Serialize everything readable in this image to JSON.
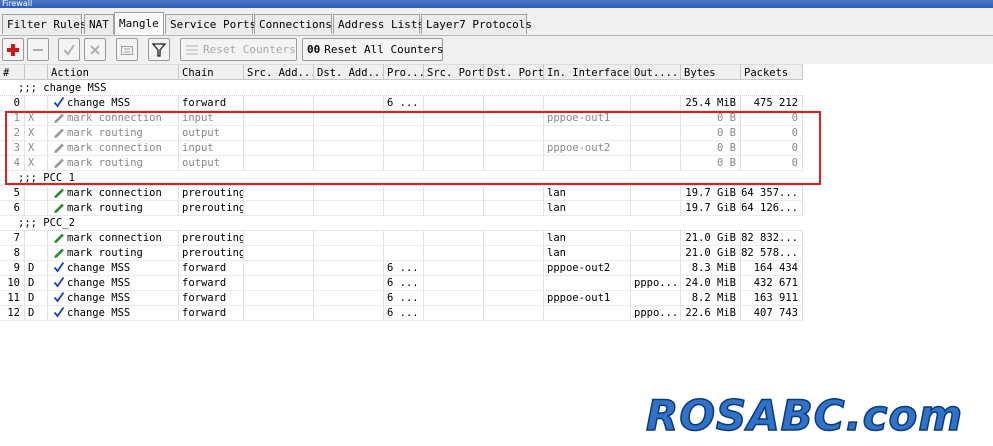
{
  "window": {
    "title": "Firewall"
  },
  "tabs": [
    "Filter Rules",
    "NAT",
    "Mangle",
    "Service Ports",
    "Connections",
    "Address Lists",
    "Layer7 Protocols"
  ],
  "active_tab": "Mangle",
  "toolbar": {
    "reset_counters": "Reset Counters",
    "reset_all_counters": "Reset All Counters",
    "reset_all_icon_text": "00"
  },
  "columns": [
    "#",
    "",
    "Action",
    "Chain",
    "Src. Add...",
    "Dst. Add...",
    "Pro...",
    "Src. Port",
    "Dst. Port",
    "In. Interface",
    "Out....",
    "Bytes",
    "Packets"
  ],
  "rows": [
    {
      "type": "comment",
      "text": ";;; change MSS"
    },
    {
      "type": "rule",
      "num": "0",
      "flag": "",
      "icon": "check-icon",
      "action": "change MSS",
      "chain": "forward",
      "src": "",
      "dst": "",
      "proto": "6 ...",
      "sport": "",
      "dport": "",
      "in": "",
      "out": "",
      "bytes": "25.4 MiB",
      "packets": "475 212"
    },
    {
      "type": "rule",
      "disabled": true,
      "num": "1",
      "flag": "X",
      "icon": "pencil-icon",
      "action": "mark connection",
      "chain": "input",
      "src": "",
      "dst": "",
      "proto": "",
      "sport": "",
      "dport": "",
      "in": "pppoe-out1",
      "out": "",
      "bytes": "0 B",
      "packets": "0"
    },
    {
      "type": "rule",
      "disabled": true,
      "num": "2",
      "flag": "X",
      "icon": "pencil-icon",
      "action": "mark routing",
      "chain": "output",
      "src": "",
      "dst": "",
      "proto": "",
      "sport": "",
      "dport": "",
      "in": "",
      "out": "",
      "bytes": "0 B",
      "packets": "0"
    },
    {
      "type": "rule",
      "disabled": true,
      "num": "3",
      "flag": "X",
      "icon": "pencil-icon",
      "action": "mark connection",
      "chain": "input",
      "src": "",
      "dst": "",
      "proto": "",
      "sport": "",
      "dport": "",
      "in": "pppoe-out2",
      "out": "",
      "bytes": "0 B",
      "packets": "0"
    },
    {
      "type": "rule",
      "disabled": true,
      "num": "4",
      "flag": "X",
      "icon": "pencil-icon",
      "action": "mark routing",
      "chain": "output",
      "src": "",
      "dst": "",
      "proto": "",
      "sport": "",
      "dport": "",
      "in": "",
      "out": "",
      "bytes": "0 B",
      "packets": "0"
    },
    {
      "type": "comment",
      "text": ";;; PCC 1"
    },
    {
      "type": "rule",
      "num": "5",
      "flag": "",
      "icon": "pencil-icon",
      "action": "mark connection",
      "chain": "prerouting",
      "src": "",
      "dst": "",
      "proto": "",
      "sport": "",
      "dport": "",
      "in": "lan",
      "out": "",
      "bytes": "19.7 GiB",
      "packets": "64 357..."
    },
    {
      "type": "rule",
      "num": "6",
      "flag": "",
      "icon": "pencil-icon",
      "action": "mark routing",
      "chain": "prerouting",
      "src": "",
      "dst": "",
      "proto": "",
      "sport": "",
      "dport": "",
      "in": "lan",
      "out": "",
      "bytes": "19.7 GiB",
      "packets": "64 126..."
    },
    {
      "type": "comment",
      "text": ";;; PCC_2"
    },
    {
      "type": "rule",
      "num": "7",
      "flag": "",
      "icon": "pencil-icon",
      "action": "mark connection",
      "chain": "prerouting",
      "src": "",
      "dst": "",
      "proto": "",
      "sport": "",
      "dport": "",
      "in": "lan",
      "out": "",
      "bytes": "21.0 GiB",
      "packets": "82 832..."
    },
    {
      "type": "rule",
      "num": "8",
      "flag": "",
      "icon": "pencil-icon",
      "action": "mark routing",
      "chain": "prerouting",
      "src": "",
      "dst": "",
      "proto": "",
      "sport": "",
      "dport": "",
      "in": "lan",
      "out": "",
      "bytes": "21.0 GiB",
      "packets": "82 578..."
    },
    {
      "type": "rule",
      "num": "9",
      "flag": "D",
      "icon": "check-icon",
      "action": "change MSS",
      "chain": "forward",
      "src": "",
      "dst": "",
      "proto": "6 ...",
      "sport": "",
      "dport": "",
      "in": "pppoe-out2",
      "out": "",
      "bytes": "8.3 MiB",
      "packets": "164 434"
    },
    {
      "type": "rule",
      "num": "10",
      "flag": "D",
      "icon": "check-icon",
      "action": "change MSS",
      "chain": "forward",
      "src": "",
      "dst": "",
      "proto": "6 ...",
      "sport": "",
      "dport": "",
      "in": "",
      "out": "pppo...",
      "bytes": "24.0 MiB",
      "packets": "432 671"
    },
    {
      "type": "rule",
      "num": "11",
      "flag": "D",
      "icon": "check-icon",
      "action": "change MSS",
      "chain": "forward",
      "src": "",
      "dst": "",
      "proto": "6 ...",
      "sport": "",
      "dport": "",
      "in": "pppoe-out1",
      "out": "",
      "bytes": "8.2 MiB",
      "packets": "163 911"
    },
    {
      "type": "rule",
      "num": "12",
      "flag": "D",
      "icon": "check-icon",
      "action": "change MSS",
      "chain": "forward",
      "src": "",
      "dst": "",
      "proto": "6 ...",
      "sport": "",
      "dport": "",
      "in": "",
      "out": "pppo...",
      "bytes": "22.6 MiB",
      "packets": "407 743"
    }
  ],
  "watermark": "ROSABC.com",
  "colors": {
    "highlight_box": "#e02020",
    "check": "#1a3fc4",
    "pencil_enabled": "#2e8b2e",
    "pencil_disabled": "#999999"
  }
}
